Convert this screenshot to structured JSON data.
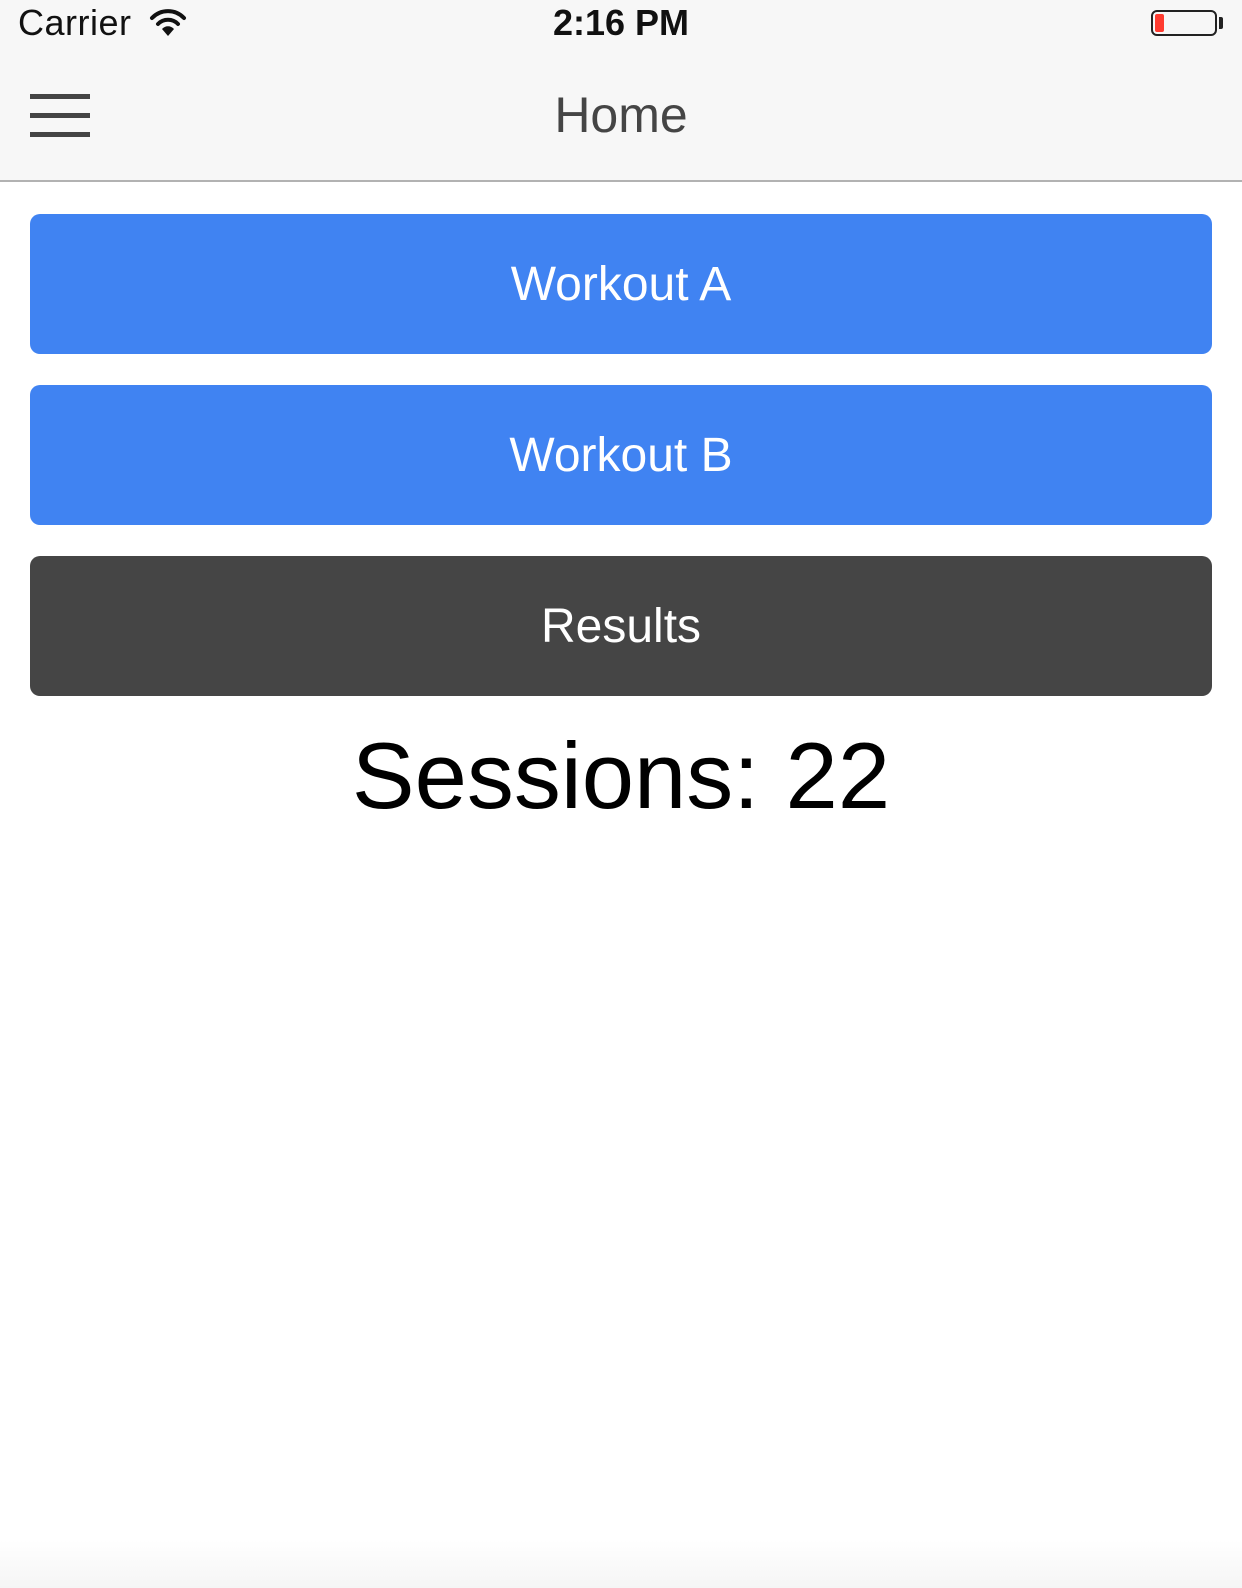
{
  "status_bar": {
    "carrier": "Carrier",
    "time": "2:16 PM",
    "battery_level": 0.15,
    "battery_color": "#ff3b30"
  },
  "nav": {
    "title": "Home",
    "menu_icon": "hamburger-menu-icon"
  },
  "buttons": {
    "workout_a": "Workout A",
    "workout_b": "Workout B",
    "results": "Results"
  },
  "sessions": {
    "label": "Sessions:",
    "count": "22"
  },
  "colors": {
    "primary": "#4083f2",
    "dark": "#454545"
  }
}
